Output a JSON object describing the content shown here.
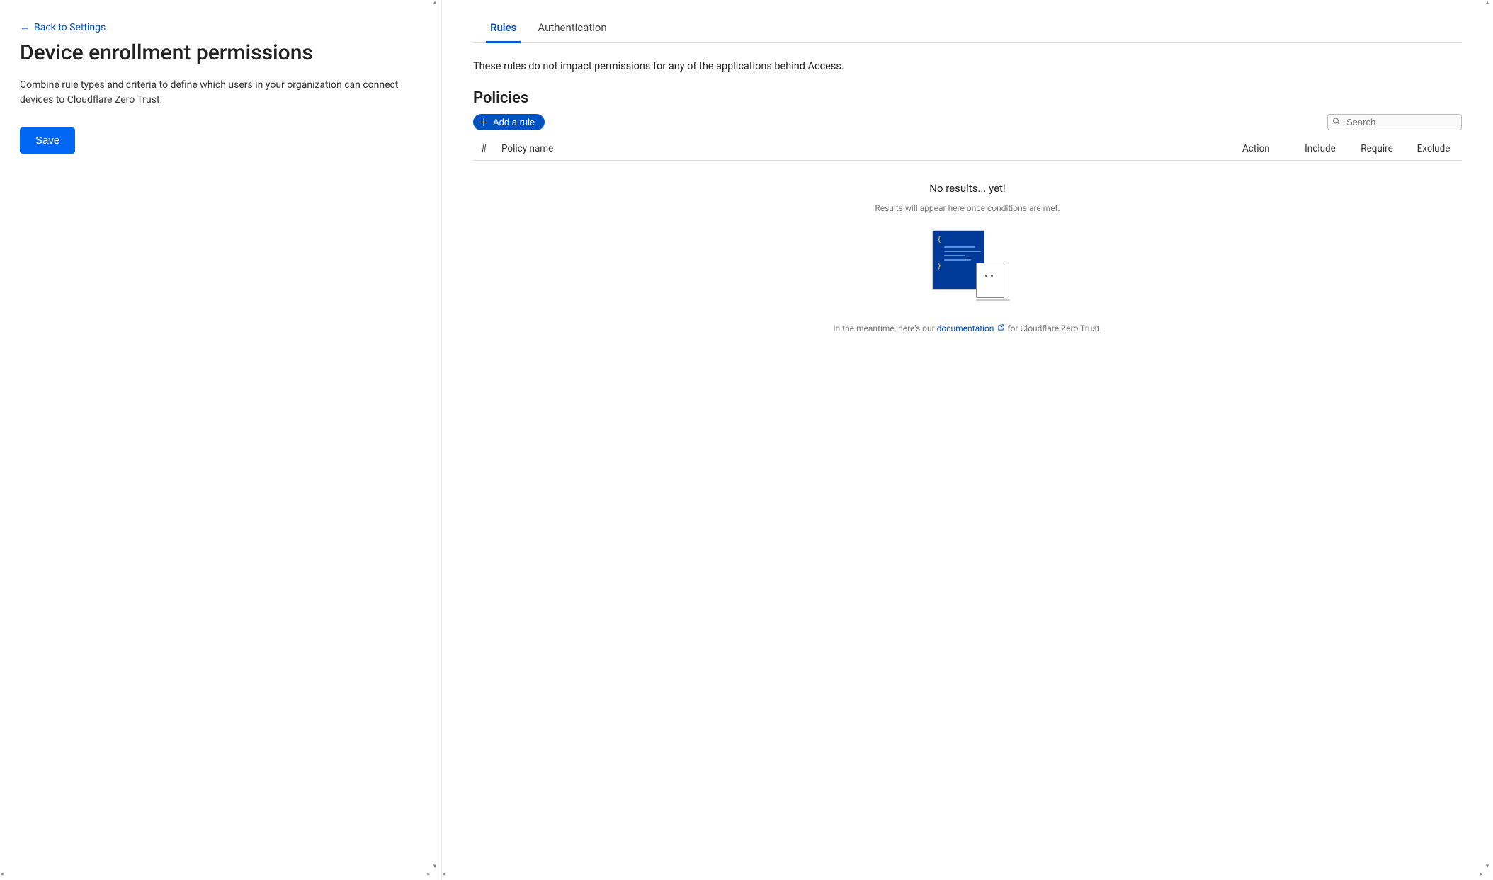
{
  "left": {
    "back_label": "Back to Settings",
    "title": "Device enrollment permissions",
    "description": "Combine rule types and criteria to define which users in your organization can connect devices to Cloudflare Zero Trust.",
    "save_label": "Save"
  },
  "tabs": {
    "rules": "Rules",
    "authentication": "Authentication"
  },
  "rules": {
    "note": "These rules do not impact permissions for any of the applications behind Access.",
    "policies_heading": "Policies",
    "add_rule_label": "Add a rule",
    "search_placeholder": "Search",
    "columns": {
      "hash": "#",
      "name": "Policy name",
      "action": "Action",
      "include": "Include",
      "require": "Require",
      "exclude": "Exclude"
    },
    "empty": {
      "title": "No results... yet!",
      "subtitle": "Results will appear here once conditions are met.",
      "footer_pre": "In the meantime, here's our ",
      "doc_label": "documentation",
      "footer_post": " for Cloudflare Zero Trust."
    }
  }
}
